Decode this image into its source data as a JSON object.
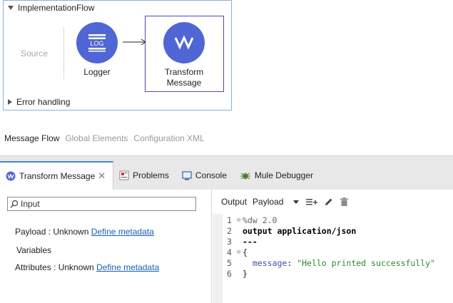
{
  "flow": {
    "name": "ImplementationFlow",
    "source_label": "Source",
    "logger_label": "Logger",
    "logger_icon_text": "LOG",
    "transform_label_line1": "Transform",
    "transform_label_line2": "Message",
    "error_handling_label": "Error handling"
  },
  "editor_tabs": [
    {
      "label": "Message Flow",
      "active": true
    },
    {
      "label": "Global Elements",
      "active": false
    },
    {
      "label": "Configuration XML",
      "active": false
    }
  ],
  "view_tabs": [
    {
      "label": "Transform Message",
      "icon": "transform-message-icon",
      "active": true,
      "close": "✕"
    },
    {
      "label": "Problems",
      "icon": "problems-icon",
      "active": false
    },
    {
      "label": "Console",
      "icon": "console-icon",
      "active": false
    },
    {
      "label": "Mule Debugger",
      "icon": "mule-debugger-icon",
      "active": false
    }
  ],
  "input_panel": {
    "search_placeholder": "Input",
    "payload_label": "Payload : Unknown ",
    "payload_link": "Define metadata",
    "variables_label": "Variables",
    "attributes_label": "Attributes : Unknown ",
    "attributes_link": "Define metadata"
  },
  "output_panel": {
    "output_label": "Output",
    "selected_target": "Payload"
  },
  "code": {
    "line1_num": "1",
    "line1_text": "%dw 2.0",
    "line2_num": "2",
    "line2_text": "output application/json",
    "line3_num": "3",
    "line3_text": "---",
    "line4_num": "4",
    "line4_text": "{",
    "line5_num": "5",
    "line5_key": "  message",
    "line5_colon": ": ",
    "line5_value": "\"Hello printed successfully\"",
    "line6_num": "6",
    "line6_text": "}"
  },
  "colors": {
    "node_blue": "#5066d4",
    "selection_border": "#4a4ab8",
    "link": "#1a5fb4",
    "active_tab_accent": "#4a86c8",
    "string_green": "#2a8a2a"
  }
}
